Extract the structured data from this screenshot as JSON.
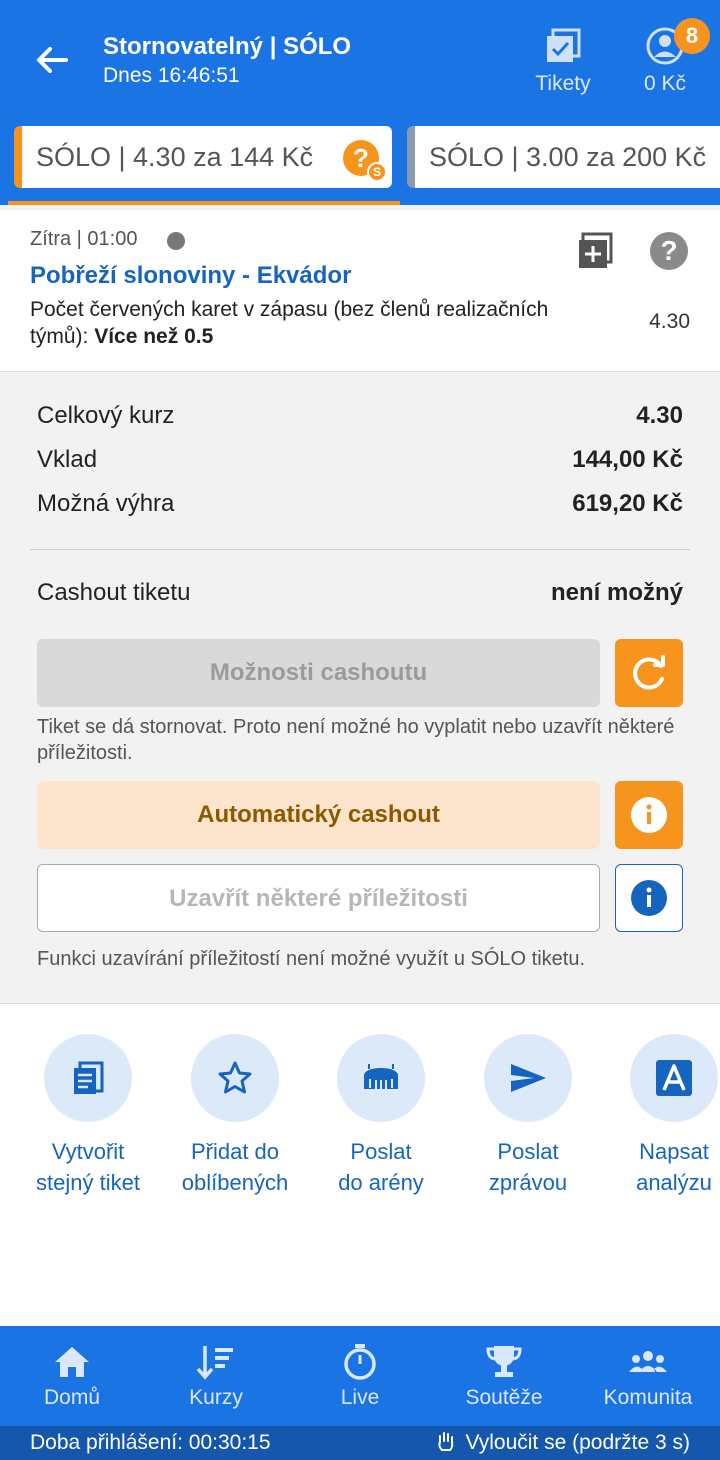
{
  "header": {
    "title": "Stornovatelný | SÓLO",
    "subtitle": "Dnes 16:46:51",
    "tickets_label": "Tikety",
    "balance": "0 Kč",
    "badge_count": "8"
  },
  "tabs": [
    {
      "label": "SÓLO  | 4.30 za 144 Kč"
    },
    {
      "label": "SÓLO  | 3.00 za 200 Kč"
    }
  ],
  "event": {
    "when": "Zítra  |  01:00",
    "match": "Pobřeží slonoviny - Ekvádor",
    "market": "Počet červených karet v zápasu (bez členů realizačních týmů):",
    "selection": "Více než 0.5",
    "odd": "4.30"
  },
  "summary": {
    "total_odds_label": "Celkový kurz",
    "total_odds": "4.30",
    "stake_label": "Vklad",
    "stake": "144,00 Kč",
    "win_label": "Možná výhra",
    "win": "619,20 Kč",
    "cashout_label": "Cashout tiketu",
    "cashout_status": "není možný"
  },
  "buttons": {
    "cashout_options": "Možnosti cashoutu",
    "cashout_note": "Tiket se dá stornovat. Proto není možné ho vyplatit nebo uzavřít některé příležitosti.",
    "auto_cashout": "Automatický cashout",
    "close_some": "Uzavřít některé příležitosti",
    "close_note": "Funkci uzavírání příležitostí není možné využít u SÓLO tiketu."
  },
  "actions": [
    {
      "line1": "Vytvořit",
      "line2": "stejný tiket",
      "icon": "copy-ticket-icon"
    },
    {
      "line1": "Přidat do",
      "line2": "oblíbených",
      "icon": "star-icon"
    },
    {
      "line1": "Poslat",
      "line2": "do arény",
      "icon": "arena-icon"
    },
    {
      "line1": "Poslat",
      "line2": "zprávou",
      "icon": "send-icon"
    },
    {
      "line1": "Napsat",
      "line2": "analýzu",
      "icon": "analysis-icon"
    }
  ],
  "nav": [
    {
      "label": "Domů",
      "icon": "home-icon"
    },
    {
      "label": "Kurzy",
      "icon": "odds-icon"
    },
    {
      "label": "Live",
      "icon": "stopwatch-icon"
    },
    {
      "label": "Soutěže",
      "icon": "trophy-icon"
    },
    {
      "label": "Komunita",
      "icon": "community-icon"
    }
  ],
  "status": {
    "login_time": "Doba přihlášení: 00:30:15",
    "exclude": "Vyloučit se (podržte 3 s)"
  },
  "colors": {
    "primary": "#1b74e4",
    "accent": "#f7941d",
    "link": "#1565c0"
  }
}
